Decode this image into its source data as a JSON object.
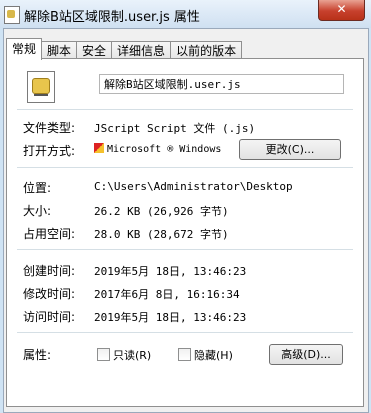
{
  "window": {
    "title": "解除B站区域限制.user.js 属性",
    "close_glyph": "✕"
  },
  "tabs": [
    {
      "label": "常规"
    },
    {
      "label": "脚本"
    },
    {
      "label": "安全"
    },
    {
      "label": "详细信息"
    },
    {
      "label": "以前的版本"
    }
  ],
  "file": {
    "name": "解除B站区域限制.user.js"
  },
  "info": {
    "type_label": "文件类型:",
    "type_value": "JScript Script 文件 (.js)",
    "open_label": "打开方式:",
    "open_value": "Microsoft ® Windows",
    "change_button": "更改(C)...",
    "location_label": "位置:",
    "location_value": "C:\\Users\\Administrator\\Desktop",
    "size_label": "大小:",
    "size_value": "26.2 KB (26,926 字节)",
    "disk_label": "占用空间:",
    "disk_value": "28.0 KB (28,672 字节)",
    "created_label": "创建时间:",
    "created_value": "2019年5月 18日, 13:46:23",
    "modified_label": "修改时间:",
    "modified_value": "2017年6月 8日, 16:16:34",
    "accessed_label": "访问时间:",
    "accessed_value": "2019年5月 18日, 13:46:23",
    "attributes_label": "属性:",
    "readonly_label": "只读(R)",
    "hidden_label": "隐藏(H)",
    "advanced_button": "高级(D)..."
  }
}
